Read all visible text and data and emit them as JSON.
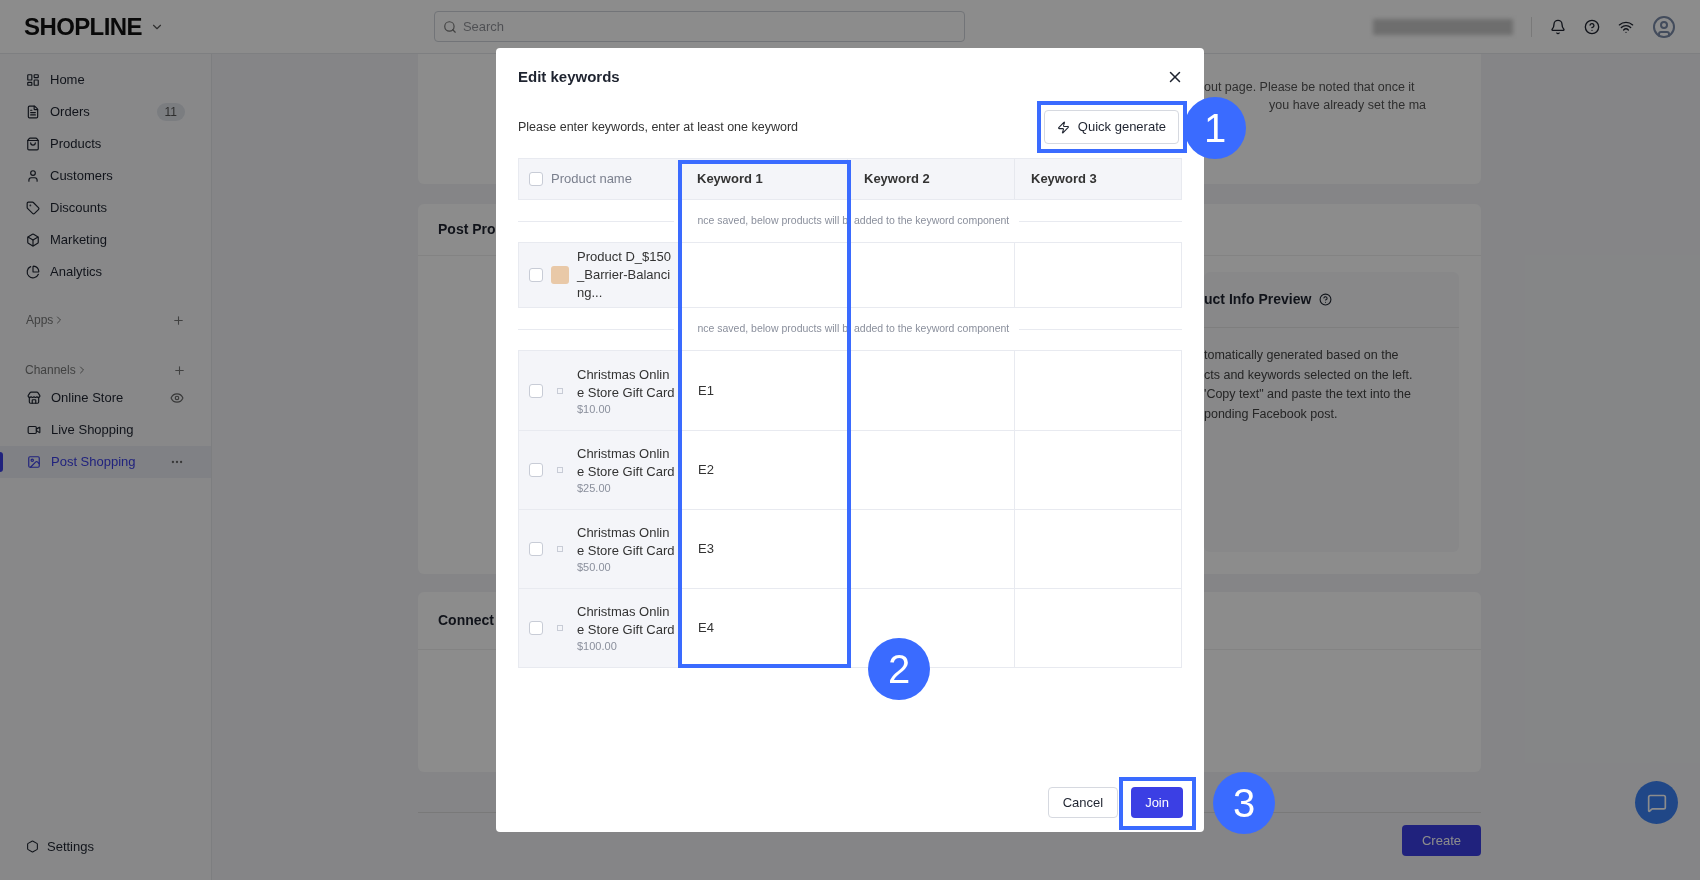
{
  "topbar": {
    "logo": "SHOPLINE",
    "search_placeholder": "Search"
  },
  "sidebar": {
    "items": [
      {
        "label": "Home",
        "selected": false
      },
      {
        "label": "Orders",
        "badge": "11",
        "selected": false
      },
      {
        "label": "Products",
        "selected": false
      },
      {
        "label": "Customers",
        "selected": false
      },
      {
        "label": "Discounts",
        "selected": false
      },
      {
        "label": "Marketing",
        "selected": false
      },
      {
        "label": "Analytics",
        "selected": false
      }
    ],
    "apps_label": "Apps",
    "channels_label": "Channels",
    "channels": [
      {
        "label": "Online Store",
        "selected": false
      },
      {
        "label": "Live Shopping",
        "selected": false
      },
      {
        "label": "Post Shopping",
        "selected": true
      }
    ],
    "settings": "Settings"
  },
  "background": {
    "notice_lines": [
      "out page. Please be noted that once it",
      "you have already set the ma"
    ],
    "post_section_title": "Post Pro",
    "preview_title": "uct Info Preview",
    "preview_lines": [
      "tomatically generated based on the",
      "cts and keywords selected on the left.",
      "'Copy text\" and paste the text into the",
      "ponding Facebook post."
    ],
    "connect_title": "Connect",
    "create_button": "Create"
  },
  "modal": {
    "title": "Edit keywords",
    "instruction": "Please enter keywords, enter at least one keyword",
    "quick_generate": "Quick generate",
    "header_checked": false,
    "columns": [
      "Product name",
      "Keyword 1",
      "Keyword 2",
      "Keyword 3"
    ],
    "groups": [
      {
        "note_parts": [
          "nce saved, below products will b",
          "added to the keyword component"
        ],
        "rows": [
          {
            "kind": "photo",
            "name": "Product D_$150_Barrier-Balancing...",
            "checked": false,
            "keywords": []
          }
        ]
      },
      {
        "note_parts": [
          "nce saved, below products will b",
          "added to the keyword component"
        ],
        "rows": [
          {
            "kind": "generic",
            "name": "Christmas Online Store Gift Card",
            "price": "$10.00",
            "checked": false,
            "keywords": [
              "E1"
            ]
          },
          {
            "kind": "generic",
            "name": "Christmas Online Store Gift Card",
            "price": "$25.00",
            "checked": false,
            "keywords": [
              "E2"
            ]
          },
          {
            "kind": "generic",
            "name": "Christmas Online Store Gift Card",
            "price": "$50.00",
            "checked": false,
            "keywords": [
              "E3"
            ]
          },
          {
            "kind": "generic",
            "name": "Christmas Online Store Gift Card",
            "price": "$100.00",
            "checked": false,
            "keywords": [
              "E4"
            ]
          }
        ]
      }
    ],
    "cancel": "Cancel",
    "join": "Join"
  },
  "annotations": [
    "1",
    "2",
    "3"
  ]
}
